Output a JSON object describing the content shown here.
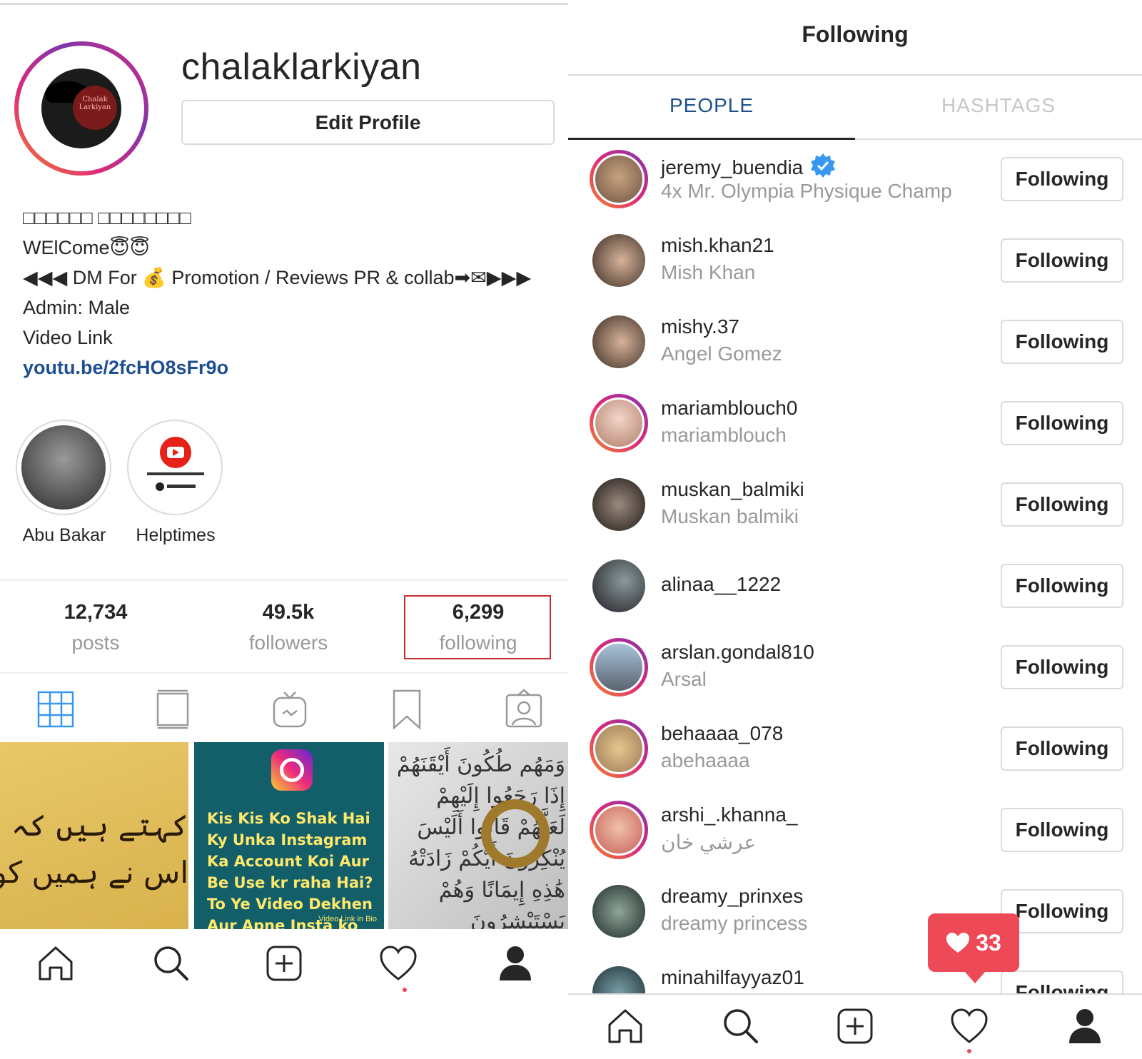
{
  "profile": {
    "username": "chalaklarkiyan",
    "edit_label": "Edit Profile",
    "bio": {
      "line1": "□□□□□□ □□□□□□□□",
      "line2": "WElCome😇😇",
      "line3": "◀◀◀ DM For 💰 Promotion / Reviews PR & collab➡✉▶▶▶",
      "line4": "Admin: Male",
      "line5": "Video Link",
      "link": "youtu.be/2fcHO8sFr9o"
    },
    "highlights": [
      {
        "label": "Abu Bakar"
      },
      {
        "label": "Helptimes"
      }
    ],
    "stats": {
      "posts_num": "12,734",
      "posts_label": "posts",
      "followers_num": "49.5k",
      "followers_label": "followers",
      "following_num": "6,299",
      "following_label": "following"
    },
    "avatar_badge": "Chalak Larkiyan",
    "posts": {
      "tile1_line1": "کہتے ہیں کہ نفرت خراب چیز ہے",
      "tile1_line2": "اس نے ہمیں کونسا جھولا جھلا",
      "tile2_text": "Kis Kis Ko Shak Hai Ky Unka Instagram Ka Account Koi Aur Be Use kr raha Hai? To Ye Video Dekhen Aur Apne Insta ko Secure kren.",
      "tile2_small": "Video Link in Bio",
      "tile3_text": "وَمَهُم طُكُونَ أَيْقَنَهُمْ إِذَا رَجَعُوا إِلَيْهِمْ لَعَلَّهُمْ قَالُوا أَلَيْسَ يُنْكِرُونَ أَيُّكُمْ زَادَتْهُ هَٰذِهِ إِيمَانًا وَهُمْ يَسْتَبْشِرُونَ"
    }
  },
  "following_panel": {
    "title": "Following",
    "tabs": [
      {
        "label": "PEOPLE"
      },
      {
        "label": "HASHTAGS"
      }
    ],
    "button_label": "Following",
    "users": [
      {
        "username": "jeremy_buendia",
        "name": "4x Mr. Olympia Physique Champ",
        "verified": true,
        "story": true
      },
      {
        "username": "mish.khan21",
        "name": "Mish Khan",
        "story": false
      },
      {
        "username": "mishy.37",
        "name": "Angel Gomez",
        "story": false
      },
      {
        "username": "mariamblouch0",
        "name": "mariamblouch",
        "story": true
      },
      {
        "username": "muskan_balmiki",
        "name": "Muskan balmiki",
        "story": false
      },
      {
        "username": "alinaa__1222",
        "name": "",
        "story": false
      },
      {
        "username": "arslan.gondal810",
        "name": "Arsal",
        "story": true
      },
      {
        "username": "behaaaa_078",
        "name": "abehaaaa",
        "story": true
      },
      {
        "username": "arshi_.khanna_",
        "name": "عرشي خان",
        "story": true
      },
      {
        "username": "dreamy_prinxes",
        "name": "dreamy princess",
        "story": false
      },
      {
        "username": "minahilfayyaz01",
        "name": "",
        "story": false
      }
    ],
    "notification_count": "33"
  },
  "colors": {
    "accent_blue": "#1d4f91",
    "notification_red": "#ed4956",
    "highlight_box": "#c62f2f",
    "muted_text": "#999999"
  },
  "icons": {
    "profile_tabs": [
      "grid-icon",
      "feed-icon",
      "igtv-icon",
      "saved-icon",
      "tagged-icon"
    ],
    "bottom_nav": [
      "home-icon",
      "search-icon",
      "add-icon",
      "heart-icon",
      "profile-icon"
    ]
  }
}
